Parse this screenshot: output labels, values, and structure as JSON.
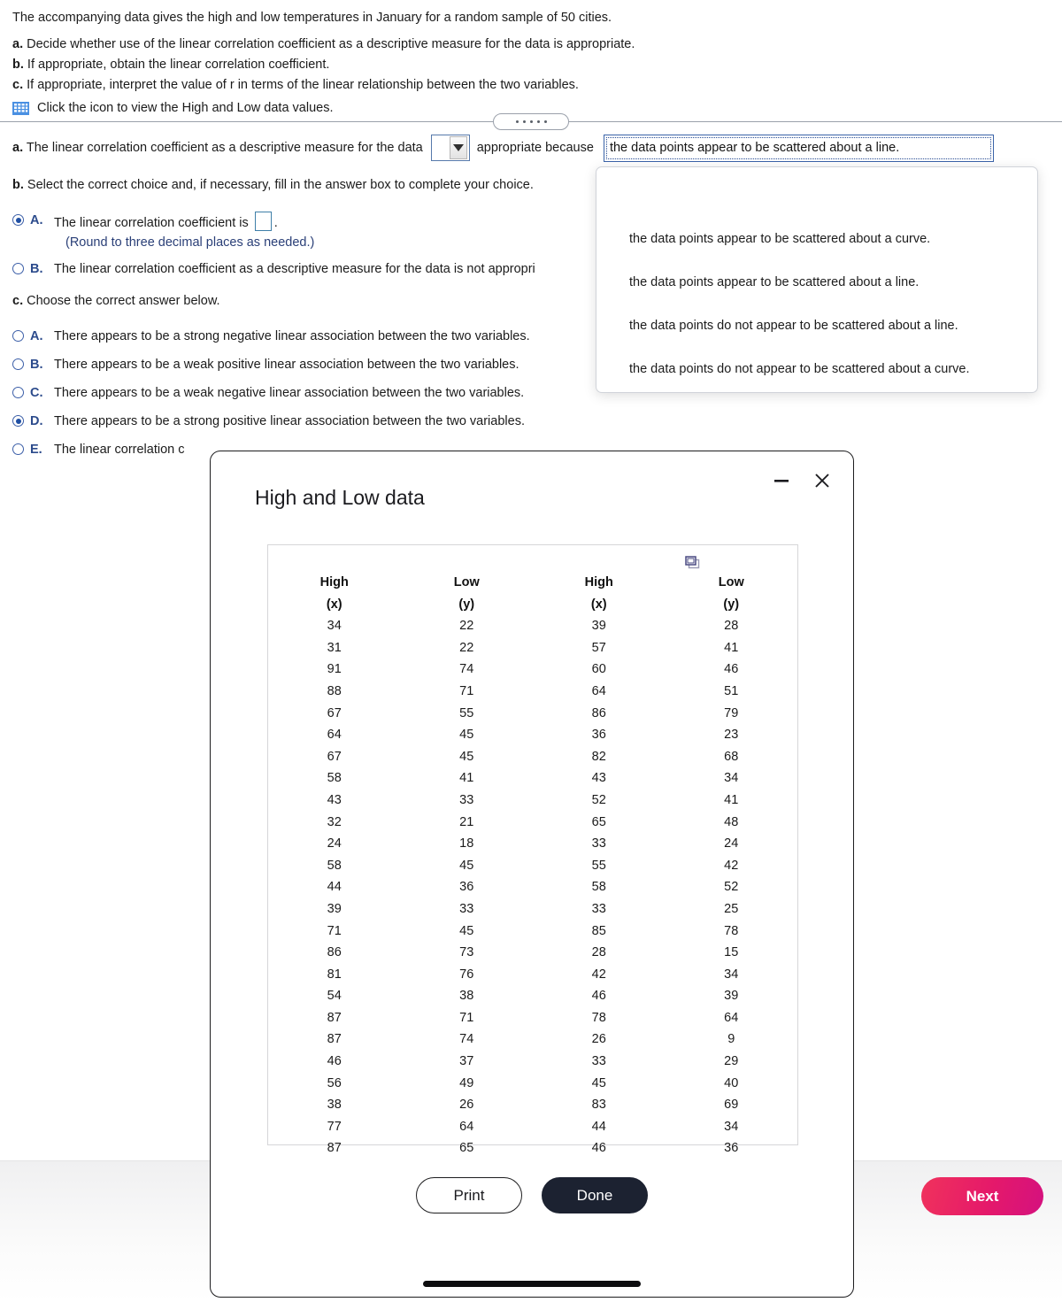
{
  "problem": {
    "intro": "The accompanying data gives the high and low temperatures in January for a random sample of 50 cities.",
    "parts": [
      {
        "label": "a.",
        "text": "Decide whether use of the linear correlation coefficient as a descriptive measure for the data is appropriate."
      },
      {
        "label": "b.",
        "text": "If appropriate, obtain the linear correlation coefficient."
      },
      {
        "label": "c.",
        "text": "If appropriate, interpret the value of r in terms of the linear relationship between the two variables."
      }
    ],
    "icon_link": "Click the icon to view the High and Low data values."
  },
  "part_a": {
    "prefix_label": "a.",
    "prefix_text": "The linear correlation coefficient as a descriptive measure for the data",
    "dropdown_value": "",
    "middle_text": "appropriate because",
    "selected_reason": "the data points appear to be scattered about a line."
  },
  "dropdown": {
    "options": [
      "the data points appear to be scattered about a curve.",
      "the data points appear to be scattered about a line.",
      "the data points do not appear to be scattered about a line.",
      "the data points do not appear to be scattered about a curve."
    ]
  },
  "part_b": {
    "label": "b.",
    "prompt": "Select the correct choice and, if necessary, fill in the answer box to complete your choice.",
    "choices": [
      {
        "letter": "A.",
        "text_before_box": "The linear correlation coefficient is",
        "text_after_box": ".",
        "selected": true,
        "has_box": true,
        "box_value": ""
      },
      {
        "letter": "B.",
        "text": "The linear correlation coefficient as a descriptive measure for the data is not appropri",
        "selected": false,
        "has_box": false
      }
    ],
    "round_note": "(Round to three decimal places as needed.)"
  },
  "part_c": {
    "label": "c.",
    "prompt": "Choose the correct answer below.",
    "choices": [
      {
        "letter": "A.",
        "text": "There appears to be a strong negative linear association between the two variables.",
        "selected": false
      },
      {
        "letter": "B.",
        "text": "There appears to be a weak positive linear association between the two variables.",
        "selected": false
      },
      {
        "letter": "C.",
        "text": "There appears to be a weak negative linear association between the two variables.",
        "selected": false
      },
      {
        "letter": "D.",
        "text": "There appears to be a strong positive linear association between the two variables.",
        "selected": true
      },
      {
        "letter": "E.",
        "text": "The linear correlation c",
        "selected": false
      }
    ]
  },
  "modal": {
    "title": "High and Low data",
    "minimize_icon": "minimize-icon",
    "close_icon": "close-icon",
    "copy_icon": "copy-icon",
    "print_label": "Print",
    "done_label": "Done",
    "headers": {
      "h1": "High",
      "h1sub": "(x)",
      "h2": "Low",
      "h2sub": "(y)",
      "h3": "High",
      "h3sub": "(x)",
      "h4": "Low",
      "h4sub": "(y)"
    },
    "rows": [
      [
        "34",
        "22",
        "39",
        "28"
      ],
      [
        "31",
        "22",
        "57",
        "41"
      ],
      [
        "91",
        "74",
        "60",
        "46"
      ],
      [
        "88",
        "71",
        "64",
        "51"
      ],
      [
        "67",
        "55",
        "86",
        "79"
      ],
      [
        "64",
        "45",
        "36",
        "23"
      ],
      [
        "67",
        "45",
        "82",
        "68"
      ],
      [
        "58",
        "41",
        "43",
        "34"
      ],
      [
        "43",
        "33",
        "52",
        "41"
      ],
      [
        "32",
        "21",
        "65",
        "48"
      ],
      [
        "24",
        "18",
        "33",
        "24"
      ],
      [
        "58",
        "45",
        "55",
        "42"
      ],
      [
        "44",
        "36",
        "58",
        "52"
      ],
      [
        "39",
        "33",
        "33",
        "25"
      ],
      [
        "71",
        "45",
        "85",
        "78"
      ],
      [
        "86",
        "73",
        "28",
        "15"
      ],
      [
        "81",
        "76",
        "42",
        "34"
      ],
      [
        "54",
        "38",
        "46",
        "39"
      ],
      [
        "87",
        "71",
        "78",
        "64"
      ],
      [
        "87",
        "74",
        "26",
        "9"
      ],
      [
        "46",
        "37",
        "33",
        "29"
      ],
      [
        "56",
        "49",
        "45",
        "40"
      ],
      [
        "38",
        "26",
        "83",
        "69"
      ],
      [
        "77",
        "64",
        "44",
        "34"
      ],
      [
        "87",
        "65",
        "46",
        "36"
      ]
    ]
  },
  "footer": {
    "next_label": "Next"
  },
  "colors": {
    "accent_blue": "#2c4b8c",
    "next_gradient_start": "#f0325c",
    "next_gradient_end": "#d4117f",
    "done_bg": "#1c2231"
  }
}
